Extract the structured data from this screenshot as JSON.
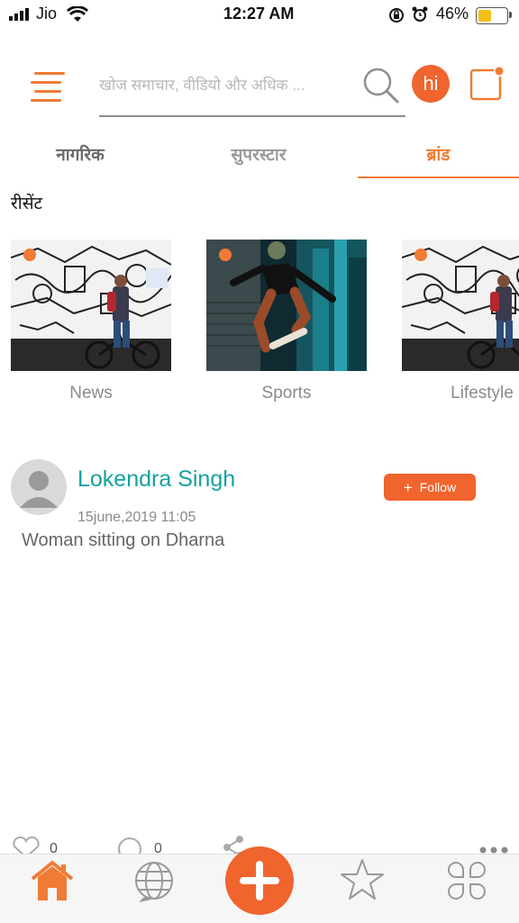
{
  "status_bar": {
    "carrier": "Jio",
    "time": "12:27 AM",
    "battery": "46%",
    "battery_level": 0.46
  },
  "header": {
    "search_placeholder": "खोज समाचार, वीडियो और अधिक ...",
    "avatar_text": "hi"
  },
  "tabs": [
    {
      "label": "नागरिक",
      "active": false
    },
    {
      "label": "सुपरस्टार",
      "active": false
    },
    {
      "label": "ब्रांड",
      "active": true
    }
  ],
  "section_title": "रीसेंट",
  "categories": [
    {
      "label": "News",
      "image": "street-art-cyclist-photo"
    },
    {
      "label": "Sports",
      "image": "skateboarder-jump-photo"
    },
    {
      "label": "Lifestyle",
      "image": "street-art-cyclist-photo"
    }
  ],
  "post": {
    "author": "Lokendra Singh",
    "date": "15june,2019 11:05",
    "text": "Woman sitting on Dharna",
    "follow_label": "Follow",
    "like_count": "0",
    "comment_count": "0"
  },
  "colors": {
    "accent": "#f07b34",
    "fab": "#f0642e",
    "author": "#17a0a0"
  },
  "bottom_nav": [
    "home-icon",
    "globe-icon",
    "add-icon",
    "star-icon",
    "apps-icon"
  ]
}
